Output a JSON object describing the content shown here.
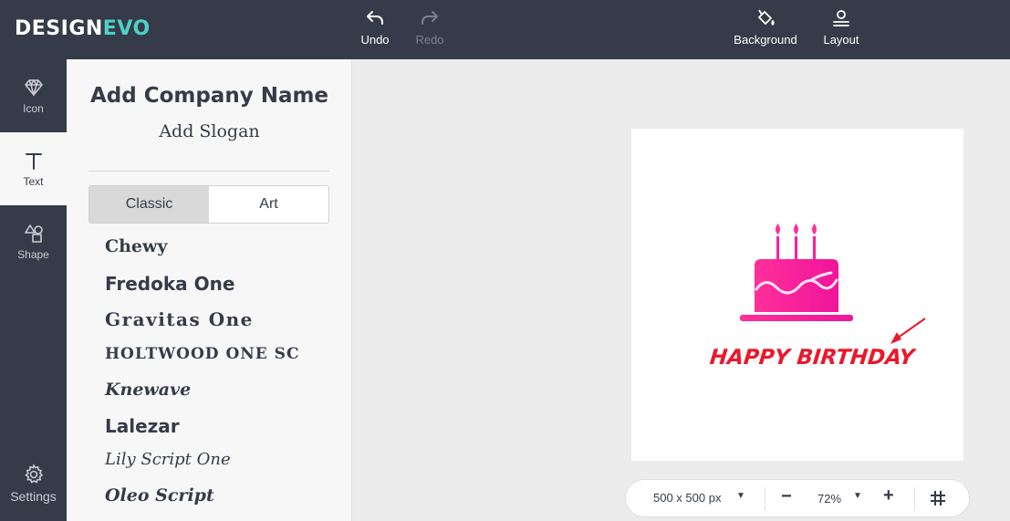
{
  "brand": {
    "name_part1": "DESIGN",
    "name_part2": "EVO"
  },
  "toolbar": {
    "undo_label": "Undo",
    "redo_label": "Redo",
    "background_label": "Background",
    "layout_label": "Layout"
  },
  "rail": {
    "icon_label": "Icon",
    "text_label": "Text",
    "shape_label": "Shape",
    "settings_label": "Settings"
  },
  "panel": {
    "company_name": "Add Company Name",
    "slogan": "Add Slogan",
    "tabs": [
      {
        "label": "Classic",
        "active": true
      },
      {
        "label": "Art",
        "active": false
      }
    ],
    "fonts": [
      "Chewy",
      "Fredoka One",
      "Gravitas One",
      "HOLTWOOD ONE SC",
      "Knewave",
      "Lalezar",
      "Lily Script One",
      "Oleo Script"
    ]
  },
  "canvas": {
    "text": "HAPPY BIRTHDAY",
    "text_color": "#e8192c",
    "cake_gradient": [
      "#ff2f9a",
      "#f0149b"
    ]
  },
  "bottom_bar": {
    "size": "500 x 500 px",
    "zoom": "72%"
  },
  "colors": {
    "topbar": "#353b48",
    "accent": "#4fd1c5"
  }
}
